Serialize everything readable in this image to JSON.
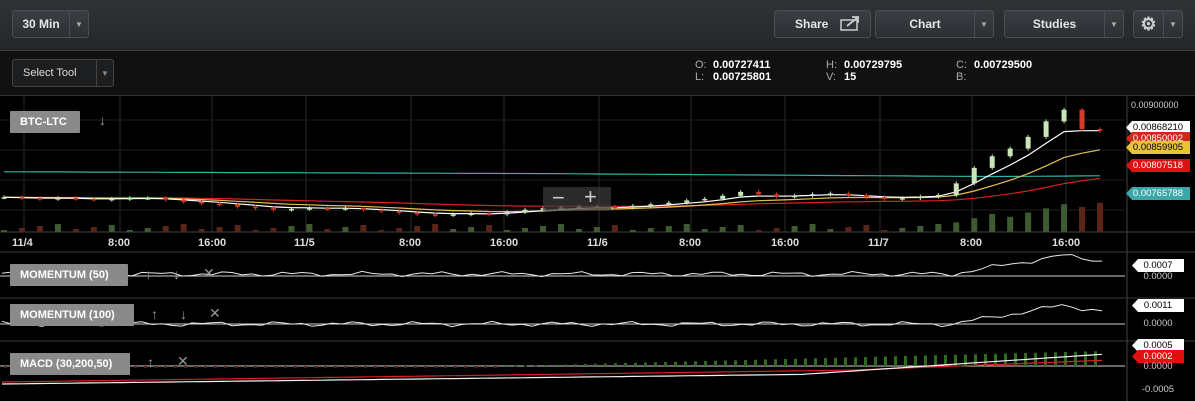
{
  "toolbar": {
    "interval": "30 Min",
    "share": "Share",
    "chart": "Chart",
    "studies": "Studies",
    "select_tool": "Select Tool"
  },
  "ohlc": {
    "o_key": "O:",
    "o_val": "0.00727411",
    "l_key": "L:",
    "l_val": "0.00725801",
    "h_key": "H:",
    "h_val": "0.00729795",
    "v_key": "V:",
    "v_val": "15",
    "c_key": "C:",
    "c_val": "0.00729500",
    "b_key": "B:",
    "b_val": ""
  },
  "main_panel": {
    "symbol": "BTC-LTC",
    "price_axis": [
      "0.00900000"
    ],
    "price_tags": [
      {
        "text": "0.00868210",
        "bg": "#ffffff",
        "fg": "#000000"
      },
      {
        "text": "0.00850002",
        "bg": "#cc2a1a",
        "fg": "#ffffff"
      },
      {
        "text": "0.00859905",
        "bg": "#e8c23a",
        "fg": "#000000"
      },
      {
        "text": "0.00807518",
        "bg": "#e01010",
        "fg": "#ffffff"
      },
      {
        "text": "0.00765788",
        "bg": "#3aa8a8",
        "fg": "#ffffff"
      }
    ]
  },
  "x_axis_labels": [
    "11/4",
    "8:00",
    "16:00",
    "11/5",
    "8:00",
    "16:00",
    "11/6",
    "8:00",
    "16:00",
    "11/7",
    "8:00",
    "16:00"
  ],
  "studies": [
    {
      "name": "MOMENTUM (50)",
      "tags": [
        "0.0007",
        "0.0000"
      ]
    },
    {
      "name": "MOMENTUM (100)",
      "tags": [
        "0.0011",
        "0.0000"
      ]
    },
    {
      "name": "MACD (30,200,50)",
      "tags": [
        "0.0005",
        "0.0002",
        "0.0000",
        "-0.0005"
      ]
    }
  ],
  "colors": {
    "up_candle": "#c9e6b8",
    "down_candle": "#d23a2a",
    "ema_fast": "#ffffff",
    "ema_mid": "#e6c050",
    "ema_slow": "#d82020",
    "ema_long": "#2fb5a8",
    "volume_up": "#3f5a30",
    "volume_down": "#5a2418"
  },
  "chart_data": {
    "type": "candlestick",
    "symbol": "BTC-LTC",
    "interval": "30 Min",
    "x_ticks": [
      "11/4",
      "8:00",
      "16:00",
      "11/5",
      "8:00",
      "16:00",
      "11/6",
      "8:00",
      "16:00",
      "11/7",
      "8:00",
      "16:00"
    ],
    "close_series": [
      0.00782,
      0.00781,
      0.0078,
      0.00781,
      0.0078,
      0.00779,
      0.0078,
      0.00781,
      0.00781,
      0.00779,
      0.00776,
      0.00774,
      0.00773,
      0.0077,
      0.00768,
      0.00766,
      0.00767,
      0.00768,
      0.00767,
      0.00768,
      0.00766,
      0.00764,
      0.00762,
      0.0076,
      0.00759,
      0.0076,
      0.00761,
      0.0076,
      0.00763,
      0.00766,
      0.00768,
      0.00769,
      0.0077,
      0.0077,
      0.00769,
      0.00771,
      0.00773,
      0.00775,
      0.00778,
      0.0078,
      0.00784,
      0.00789,
      0.00786,
      0.00783,
      0.00784,
      0.00786,
      0.00787,
      0.00785,
      0.00782,
      0.0078,
      0.00781,
      0.00783,
      0.00785,
      0.008,
      0.0082,
      0.00835,
      0.00845,
      0.0086,
      0.0088,
      0.00895,
      0.0087,
      0.00868
    ],
    "ema_fast_last": 0.0086821,
    "ema_mid_last": 0.00859905,
    "ema_slow_last": 0.00807518,
    "ema_long_last": 0.00765788,
    "last_price": 0.00850002,
    "y_axis_top_label": 0.009,
    "momentum_50": {
      "last": 0.0007,
      "zero": 0.0
    },
    "momentum_100": {
      "last": 0.0011,
      "zero": 0.0
    },
    "macd": {
      "params": "30,200,50",
      "macd_last": 0.0005,
      "signal_last": 0.0002,
      "labels": [
        0.0,
        -0.0005
      ]
    }
  }
}
